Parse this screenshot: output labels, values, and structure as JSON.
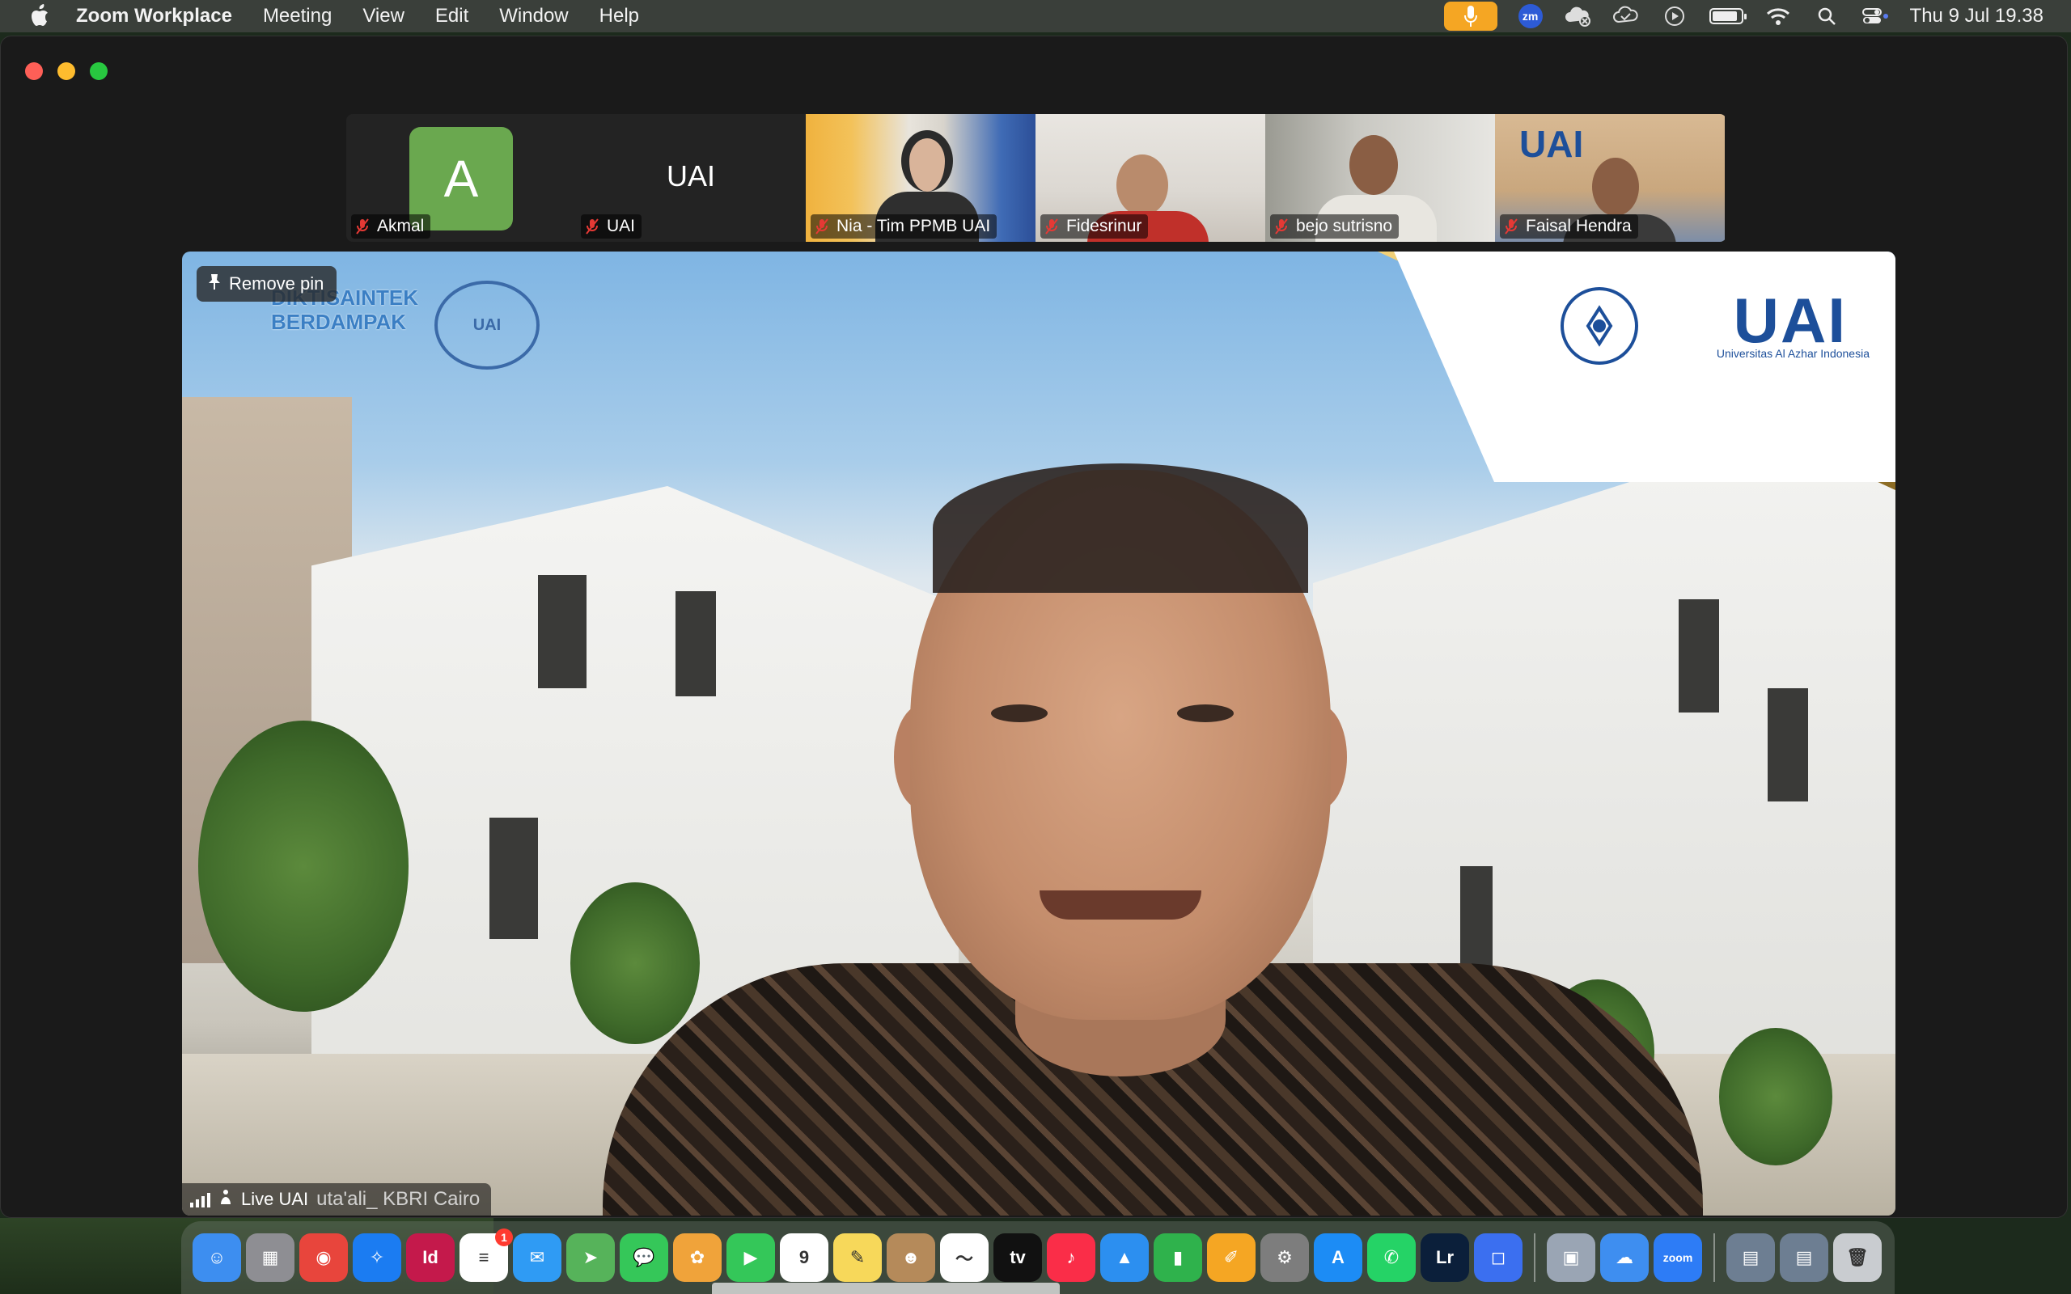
{
  "menubar": {
    "app_name": "Zoom Workplace",
    "items": [
      "Meeting",
      "View",
      "Edit",
      "Window",
      "Help"
    ],
    "zoom_badge": "zm",
    "clock": "Thu 9 Jul  19.38"
  },
  "gallery": {
    "tiles": [
      {
        "name": "Akmal",
        "avatar_letter": "A",
        "muted": true
      },
      {
        "name": "UAI",
        "display_text": "UAI",
        "muted": true
      },
      {
        "name": "Nia - Tim PPMB UAI",
        "muted": true
      },
      {
        "name": "Fidesrinur",
        "muted": true
      },
      {
        "name": "bejo sutrisno",
        "muted": true
      },
      {
        "name": "Faisal Hendra",
        "muted": true
      }
    ]
  },
  "main_video": {
    "remove_pin_label": "Remove pin",
    "banner_line1": "DIKTISAINTEK",
    "banner_line2": "BERDAMPAK",
    "seal_text": "UAI",
    "logo_text": "UAI",
    "logo_subtitle": "Universitas Al Azhar Indonesia",
    "speaker_name": "Live UAI",
    "background_caption": "uta'ali_ KBRI Cairo"
  },
  "dock": {
    "apps": [
      {
        "name": "Finder",
        "color": "#3d8ef0",
        "glyph": "☺"
      },
      {
        "name": "Launchpad",
        "color": "#8e8e93",
        "glyph": "▦"
      },
      {
        "name": "Chrome",
        "color": "#e8453c",
        "glyph": "◉"
      },
      {
        "name": "Safari",
        "color": "#1b7cf2",
        "glyph": "✧"
      },
      {
        "name": "InDesign",
        "color": "#c4194b",
        "glyph": "Id"
      },
      {
        "name": "Reminders",
        "color": "#ffffff",
        "glyph": "≡",
        "badge": "1"
      },
      {
        "name": "Mail",
        "color": "#2f9bf4",
        "glyph": "✉"
      },
      {
        "name": "Maps",
        "color": "#56b35a",
        "glyph": "➤"
      },
      {
        "name": "Messages",
        "color": "#35c759",
        "glyph": "💬"
      },
      {
        "name": "Photos",
        "color": "#f0a33a",
        "glyph": "✿"
      },
      {
        "name": "FaceTime",
        "color": "#34c759",
        "glyph": "▶"
      },
      {
        "name": "Calendar",
        "color": "#ffffff",
        "glyph": "9"
      },
      {
        "name": "Notes",
        "color": "#f7d85a",
        "glyph": "✎"
      },
      {
        "name": "Contacts",
        "color": "#b58a5a",
        "glyph": "☻"
      },
      {
        "name": "Freeform",
        "color": "#ffffff",
        "glyph": "〜"
      },
      {
        "name": "TV",
        "color": "#111111",
        "glyph": "tv"
      },
      {
        "name": "Music",
        "color": "#fa2d48",
        "glyph": "♪"
      },
      {
        "name": "Keynote",
        "color": "#2c8ff0",
        "glyph": "▲"
      },
      {
        "name": "Numbers",
        "color": "#2fb24c",
        "glyph": "▮"
      },
      {
        "name": "Pages",
        "color": "#f5a623",
        "glyph": "✐"
      },
      {
        "name": "System Settings",
        "color": "#7d7d7d",
        "glyph": "⚙"
      },
      {
        "name": "App Store",
        "color": "#1c8cf5",
        "glyph": "A"
      },
      {
        "name": "WhatsApp",
        "color": "#25d366",
        "glyph": "✆"
      },
      {
        "name": "Lightroom",
        "color": "#0b1f3a",
        "glyph": "Lr"
      },
      {
        "name": "Screen Sharing",
        "color": "#3b6ff0",
        "glyph": "◻"
      }
    ],
    "apps2": [
      {
        "name": "Preview",
        "color": "#9aa5b4",
        "glyph": "▣"
      },
      {
        "name": "iCloud Drive",
        "color": "#3e8ef0",
        "glyph": "☁"
      },
      {
        "name": "Zoom",
        "color": "#2d7cf6",
        "glyph": "zoom"
      }
    ],
    "recents": [
      {
        "name": "Recent window 1",
        "color": "#6d7e92",
        "glyph": "▤"
      },
      {
        "name": "Recent window 2",
        "color": "#6d7e92",
        "glyph": "▤"
      },
      {
        "name": "Trash",
        "color": "#c9ccd0",
        "glyph": "🗑"
      }
    ]
  },
  "colors": {
    "accent_mic": "#f5a623",
    "muted_red": "#e53935",
    "avatar_green": "#6aa84f"
  }
}
